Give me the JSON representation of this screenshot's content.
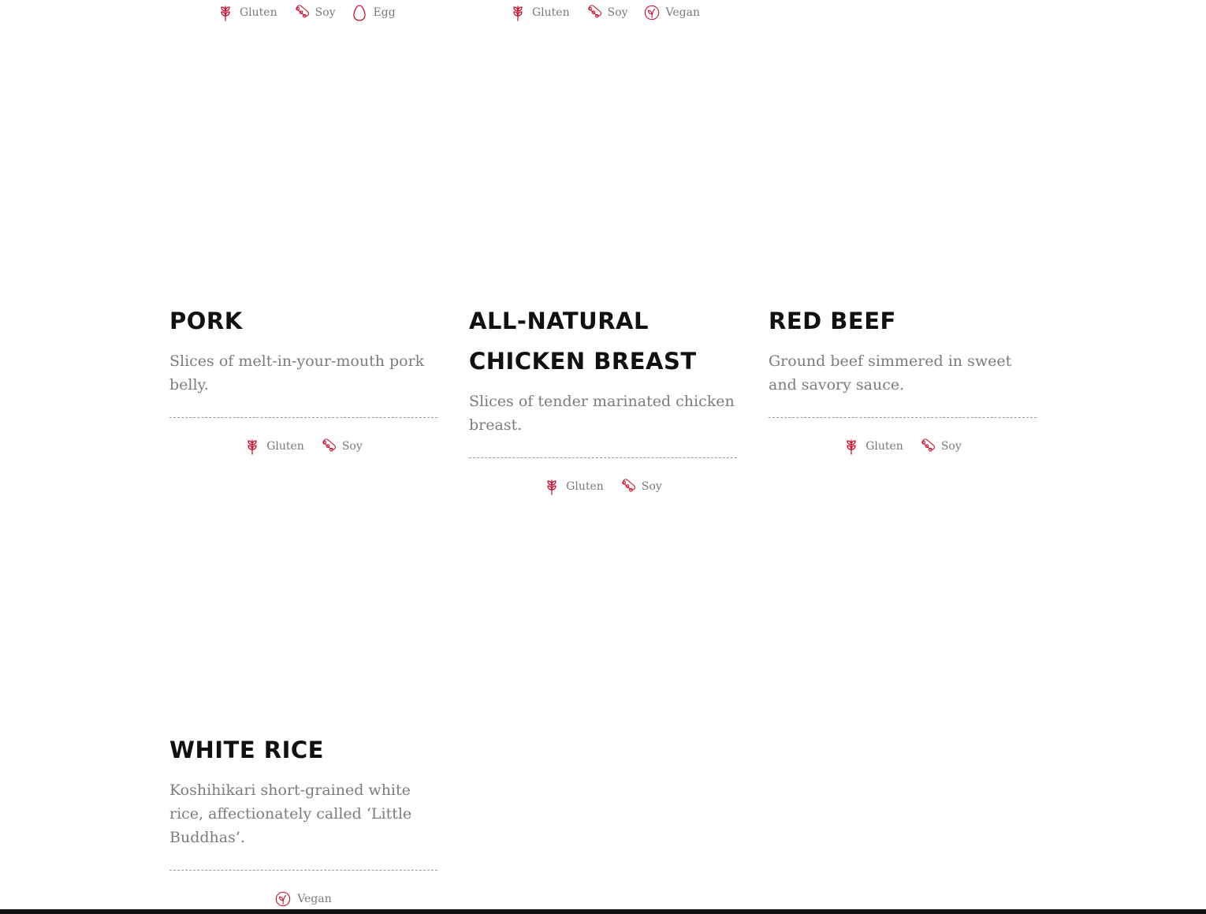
{
  "accent_color": "#c8102e",
  "top_rows": [
    {
      "allergens": [
        {
          "label": "Gluten",
          "icon": "wheat-icon"
        },
        {
          "label": "Soy",
          "icon": "soybean-icon"
        },
        {
          "label": "Egg",
          "icon": "egg-icon"
        }
      ]
    },
    {
      "allergens": [
        {
          "label": "Gluten",
          "icon": "wheat-icon"
        },
        {
          "label": "Soy",
          "icon": "soybean-icon"
        },
        {
          "label": "Vegan",
          "icon": "leaf-icon"
        }
      ]
    }
  ],
  "menu_items": [
    {
      "title": "PORK",
      "description": "Slices of melt-in-your-mouth pork belly.",
      "allergens": [
        {
          "label": "Gluten",
          "icon": "wheat-icon"
        },
        {
          "label": "Soy",
          "icon": "soybean-icon"
        }
      ]
    },
    {
      "title": "ALL-NATURAL CHICKEN BREAST",
      "description": "Slices of tender marinated chicken breast.",
      "allergens": [
        {
          "label": "Gluten",
          "icon": "wheat-icon"
        },
        {
          "label": "Soy",
          "icon": "soybean-icon"
        }
      ]
    },
    {
      "title": "RED BEEF",
      "description": "Ground beef simmered in sweet and savory sauce.",
      "allergens": [
        {
          "label": "Gluten",
          "icon": "wheat-icon"
        },
        {
          "label": "Soy",
          "icon": "soybean-icon"
        }
      ]
    },
    {
      "title": "WHITE RICE",
      "description": "Koshihikari short-grained white rice, affectionately called ‘Little Buddhas’.",
      "allergens": [
        {
          "label": "Vegan",
          "icon": "leaf-icon"
        }
      ]
    }
  ]
}
